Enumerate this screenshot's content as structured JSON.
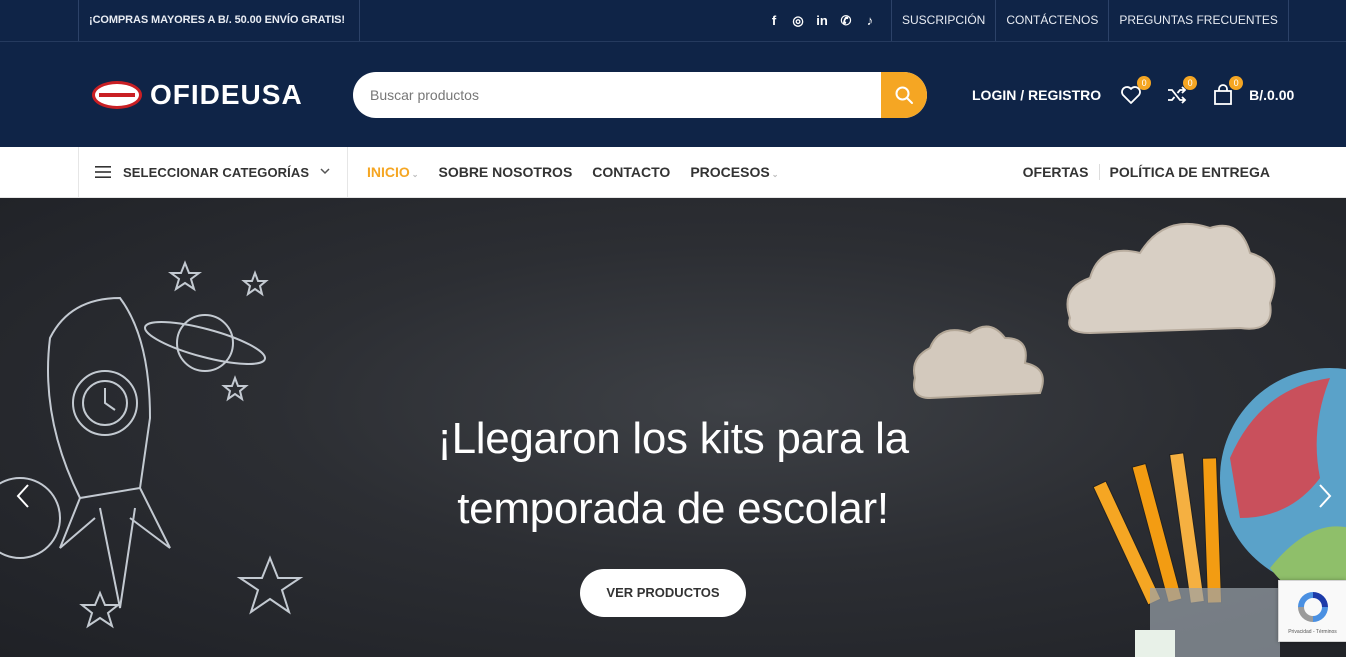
{
  "topbar": {
    "promo": "¡COMPRAS MAYORES A B/. 50.00 ENVÍO GRATIS!",
    "socials": [
      {
        "icon": "facebook-icon",
        "glyph": "f"
      },
      {
        "icon": "instagram-icon",
        "glyph": "◎"
      },
      {
        "icon": "linkedin-icon",
        "glyph": "in"
      },
      {
        "icon": "whatsapp-icon",
        "glyph": "✆"
      },
      {
        "icon": "tiktok-icon",
        "glyph": "♪"
      }
    ],
    "links": [
      "SUSCRIPCIÓN",
      "CONTÁCTENOS",
      "PREGUNTAS FRECUENTES"
    ]
  },
  "header": {
    "logo_text": "OFIDEUSA",
    "search_placeholder": "Buscar productos",
    "login": "LOGIN / REGISTRO",
    "wishlist_count": "0",
    "compare_count": "0",
    "cart_count": "0",
    "cart_total": "B/.0.00"
  },
  "nav": {
    "categories": "SELECCIONAR CATEGORÍAS",
    "menu": [
      "INICIO",
      "SOBRE NOSOTROS",
      "CONTACTO",
      "PROCESOS"
    ],
    "right": [
      "OFERTAS",
      "POLÍTICA DE ENTREGA"
    ]
  },
  "hero": {
    "title_line1": "¡Llegaron los kits para la",
    "title_line2": "temporada de escolar!",
    "button": "VER PRODUCTOS"
  },
  "recaptcha": {
    "text": "Privacidad - Términos"
  },
  "colors": {
    "navy": "#0f2447",
    "accent": "#f5a623",
    "chalkboard": "#2c2e33"
  }
}
